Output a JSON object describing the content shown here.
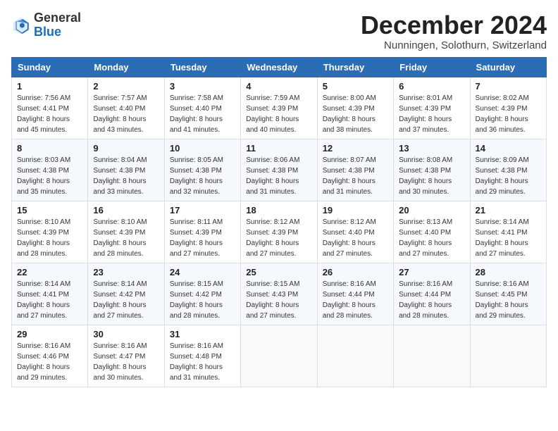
{
  "header": {
    "logo_general": "General",
    "logo_blue": "Blue",
    "month_title": "December 2024",
    "location": "Nunningen, Solothurn, Switzerland"
  },
  "days_of_week": [
    "Sunday",
    "Monday",
    "Tuesday",
    "Wednesday",
    "Thursday",
    "Friday",
    "Saturday"
  ],
  "weeks": [
    [
      {
        "day": "1",
        "sunrise": "7:56 AM",
        "sunset": "4:41 PM",
        "daylight": "8 hours and 45 minutes."
      },
      {
        "day": "2",
        "sunrise": "7:57 AM",
        "sunset": "4:40 PM",
        "daylight": "8 hours and 43 minutes."
      },
      {
        "day": "3",
        "sunrise": "7:58 AM",
        "sunset": "4:40 PM",
        "daylight": "8 hours and 41 minutes."
      },
      {
        "day": "4",
        "sunrise": "7:59 AM",
        "sunset": "4:39 PM",
        "daylight": "8 hours and 40 minutes."
      },
      {
        "day": "5",
        "sunrise": "8:00 AM",
        "sunset": "4:39 PM",
        "daylight": "8 hours and 38 minutes."
      },
      {
        "day": "6",
        "sunrise": "8:01 AM",
        "sunset": "4:39 PM",
        "daylight": "8 hours and 37 minutes."
      },
      {
        "day": "7",
        "sunrise": "8:02 AM",
        "sunset": "4:39 PM",
        "daylight": "8 hours and 36 minutes."
      }
    ],
    [
      {
        "day": "8",
        "sunrise": "8:03 AM",
        "sunset": "4:38 PM",
        "daylight": "8 hours and 35 minutes."
      },
      {
        "day": "9",
        "sunrise": "8:04 AM",
        "sunset": "4:38 PM",
        "daylight": "8 hours and 33 minutes."
      },
      {
        "day": "10",
        "sunrise": "8:05 AM",
        "sunset": "4:38 PM",
        "daylight": "8 hours and 32 minutes."
      },
      {
        "day": "11",
        "sunrise": "8:06 AM",
        "sunset": "4:38 PM",
        "daylight": "8 hours and 31 minutes."
      },
      {
        "day": "12",
        "sunrise": "8:07 AM",
        "sunset": "4:38 PM",
        "daylight": "8 hours and 31 minutes."
      },
      {
        "day": "13",
        "sunrise": "8:08 AM",
        "sunset": "4:38 PM",
        "daylight": "8 hours and 30 minutes."
      },
      {
        "day": "14",
        "sunrise": "8:09 AM",
        "sunset": "4:38 PM",
        "daylight": "8 hours and 29 minutes."
      }
    ],
    [
      {
        "day": "15",
        "sunrise": "8:10 AM",
        "sunset": "4:39 PM",
        "daylight": "8 hours and 28 minutes."
      },
      {
        "day": "16",
        "sunrise": "8:10 AM",
        "sunset": "4:39 PM",
        "daylight": "8 hours and 28 minutes."
      },
      {
        "day": "17",
        "sunrise": "8:11 AM",
        "sunset": "4:39 PM",
        "daylight": "8 hours and 27 minutes."
      },
      {
        "day": "18",
        "sunrise": "8:12 AM",
        "sunset": "4:39 PM",
        "daylight": "8 hours and 27 minutes."
      },
      {
        "day": "19",
        "sunrise": "8:12 AM",
        "sunset": "4:40 PM",
        "daylight": "8 hours and 27 minutes."
      },
      {
        "day": "20",
        "sunrise": "8:13 AM",
        "sunset": "4:40 PM",
        "daylight": "8 hours and 27 minutes."
      },
      {
        "day": "21",
        "sunrise": "8:14 AM",
        "sunset": "4:41 PM",
        "daylight": "8 hours and 27 minutes."
      }
    ],
    [
      {
        "day": "22",
        "sunrise": "8:14 AM",
        "sunset": "4:41 PM",
        "daylight": "8 hours and 27 minutes."
      },
      {
        "day": "23",
        "sunrise": "8:14 AM",
        "sunset": "4:42 PM",
        "daylight": "8 hours and 27 minutes."
      },
      {
        "day": "24",
        "sunrise": "8:15 AM",
        "sunset": "4:42 PM",
        "daylight": "8 hours and 28 minutes."
      },
      {
        "day": "25",
        "sunrise": "8:15 AM",
        "sunset": "4:43 PM",
        "daylight": "8 hours and 27 minutes."
      },
      {
        "day": "26",
        "sunrise": "8:16 AM",
        "sunset": "4:44 PM",
        "daylight": "8 hours and 28 minutes."
      },
      {
        "day": "27",
        "sunrise": "8:16 AM",
        "sunset": "4:44 PM",
        "daylight": "8 hours and 28 minutes."
      },
      {
        "day": "28",
        "sunrise": "8:16 AM",
        "sunset": "4:45 PM",
        "daylight": "8 hours and 29 minutes."
      }
    ],
    [
      {
        "day": "29",
        "sunrise": "8:16 AM",
        "sunset": "4:46 PM",
        "daylight": "8 hours and 29 minutes."
      },
      {
        "day": "30",
        "sunrise": "8:16 AM",
        "sunset": "4:47 PM",
        "daylight": "8 hours and 30 minutes."
      },
      {
        "day": "31",
        "sunrise": "8:16 AM",
        "sunset": "4:48 PM",
        "daylight": "8 hours and 31 minutes."
      },
      null,
      null,
      null,
      null
    ]
  ]
}
